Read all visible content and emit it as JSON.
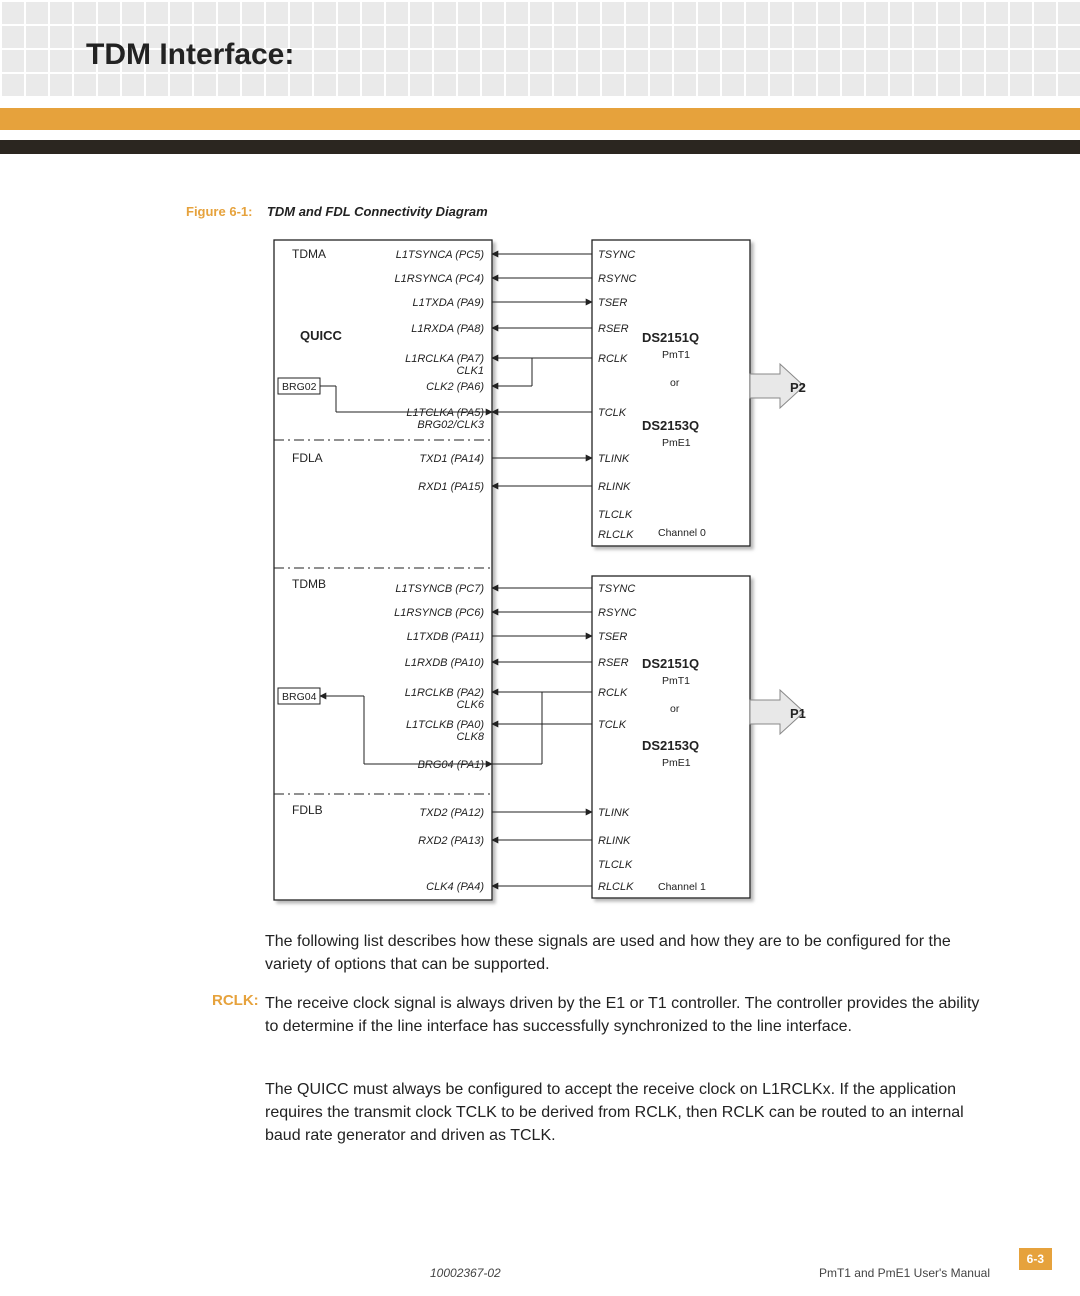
{
  "header": {
    "title": "TDM Interface:"
  },
  "figure": {
    "label": "Figure 6-1:",
    "title": "TDM and FDL Connectivity Diagram"
  },
  "diagram": {
    "left_block": {
      "title": "QUICC",
      "sections": [
        "TDMA",
        "FDLA",
        "TDMB",
        "FDLB"
      ],
      "tdma_pins": [
        "L1TSYNCA (PC5)",
        "L1RSYNCA (PC4)",
        "L1TXDA (PA9)",
        "L1RXDA (PA8)",
        "L1RCLKA (PA7)",
        "CLK1",
        "CLK2 (PA6)",
        "L1TCLKA (PA5)",
        "BRG02/CLK3"
      ],
      "fdla_pins": [
        "TXD1 (PA14)",
        "RXD1 (PA15)"
      ],
      "tdmb_pins": [
        "L1TSYNCB (PC7)",
        "L1RSYNCB (PC6)",
        "L1TXDB (PA11)",
        "L1RXDB (PA10)",
        "L1RCLKB (PA2)",
        "CLK6",
        "L1TCLKB (PA0)",
        "CLK8",
        "BRG04 (PA1)"
      ],
      "fdlb_pins": [
        "TXD2 (PA12)",
        "RXD2 (PA13)",
        "CLK4 (PA4)"
      ],
      "brg_boxes": [
        "BRG02",
        "BRG04"
      ]
    },
    "right_blocks": {
      "chip1": "DS2151Q",
      "sub1": "PmT1",
      "or": "or",
      "chip2": "DS2153Q",
      "sub2": "PmE1",
      "ch0": "Channel 0",
      "ch1": "Channel 1",
      "signals": [
        "TSYNC",
        "RSYNC",
        "TSER",
        "RSER",
        "RCLK",
        "TCLK",
        "TLINK",
        "RLINK",
        "TLCLK",
        "RLCLK"
      ]
    },
    "ports": {
      "p1": "P1",
      "p2": "P2"
    }
  },
  "body": {
    "intro": "The following list describes how these signals are used and how they are to be configured for the variety of options that can be supported.",
    "rclk_label": "RCLK:",
    "rclk_p1": "The receive clock signal is always driven by the E1 or T1 controller. The controller provides the ability to determine if the line interface has successfully synchronized to the line interface.",
    "rclk_p2": "The QUICC must always be configured to accept the receive clock on L1RCLKx. If the application requires the transmit clock TCLK to be derived from RCLK, then RCLK can be routed to an internal baud rate generator and driven as TCLK."
  },
  "footer": {
    "docnum": "10002367-02",
    "manual": "PmT1 and PmE1 User's Manual",
    "pagenum": "6-3"
  }
}
